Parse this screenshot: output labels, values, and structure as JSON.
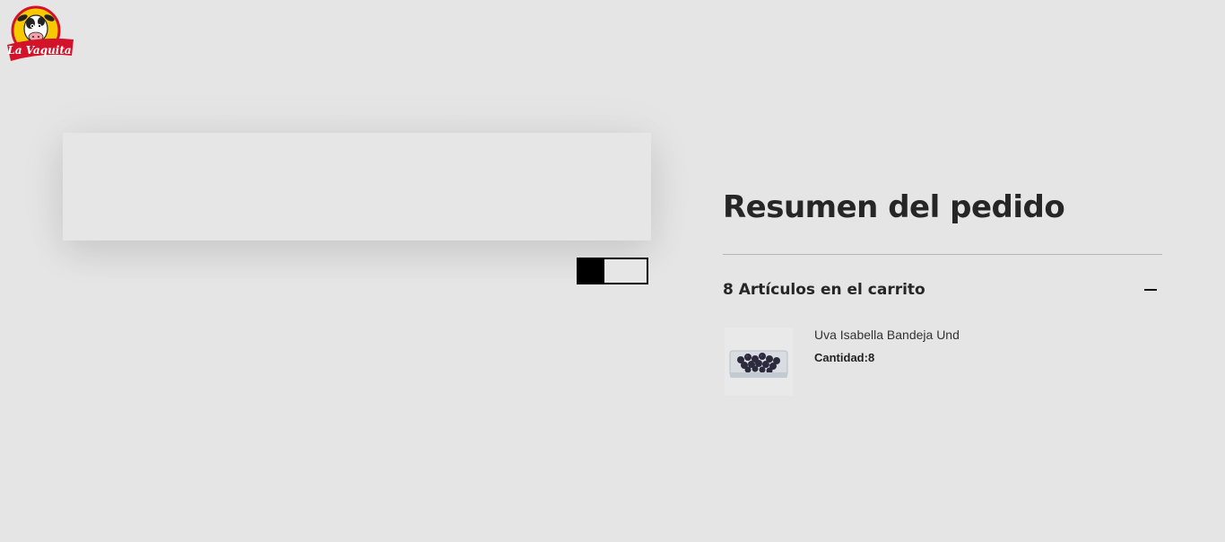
{
  "header": {
    "logo_text": "La Vaquita"
  },
  "checkout": {
    "progress_fraction": 0.38
  },
  "summary": {
    "title": "Resumen del pedido",
    "cart_count_label": "8 Artículos en el carrito",
    "collapse_icon": "minus-icon",
    "items": [
      {
        "name": "Uva Isabella Bandeja Und",
        "quantity_label": "Cantidad:8"
      }
    ]
  },
  "colors": {
    "background": "#e5e5e5",
    "logo_red": "#d3132a",
    "logo_yellow": "#f6c900",
    "text_dark": "#262626"
  }
}
